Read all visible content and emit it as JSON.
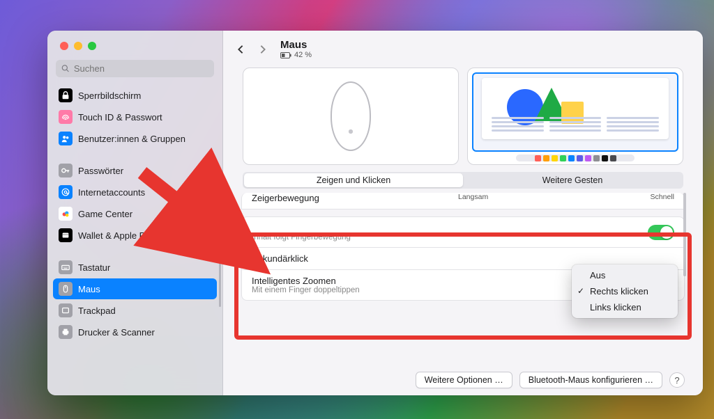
{
  "search": {
    "placeholder": "Suchen"
  },
  "sidebar": {
    "items": [
      {
        "label": "Sperrbildschirm",
        "icon": "lock-screen",
        "bg": "#000",
        "fg": "#fff"
      },
      {
        "label": "Touch ID & Passwort",
        "icon": "touchid",
        "bg": "#ff7aa8",
        "fg": "#fff"
      },
      {
        "label": "Benutzer:innen & Gruppen",
        "icon": "users",
        "bg": "#0a82ff",
        "fg": "#fff"
      },
      {
        "label": "Passwörter",
        "icon": "key",
        "bg": "#a1a1a8",
        "fg": "#fff"
      },
      {
        "label": "Internetaccounts",
        "icon": "at",
        "bg": "#0a82ff",
        "fg": "#fff"
      },
      {
        "label": "Game Center",
        "icon": "gamecenter",
        "bg": "#fff",
        "fg": "#ff4b4b"
      },
      {
        "label": "Wallet & Apple Pay",
        "icon": "wallet",
        "bg": "#000",
        "fg": "#fff"
      },
      {
        "label": "Tastatur",
        "icon": "keyboard",
        "bg": "#a1a1a8",
        "fg": "#fff"
      },
      {
        "label": "Maus",
        "icon": "mouse",
        "bg": "#a1a1a8",
        "fg": "#fff",
        "selected": true
      },
      {
        "label": "Trackpad",
        "icon": "trackpad",
        "bg": "#a1a1a8",
        "fg": "#fff"
      },
      {
        "label": "Drucker & Scanner",
        "icon": "printer",
        "bg": "#a1a1a8",
        "fg": "#fff"
      }
    ]
  },
  "header": {
    "title": "Maus",
    "battery": "42 %"
  },
  "tabs": {
    "a": "Zeigen und Klicken",
    "b": "Weitere Gesten"
  },
  "rows": {
    "tracking": {
      "label": "Zeigerbewegung",
      "slow": "Langsam",
      "fast": "Schnell"
    },
    "scroll": {
      "sub": "Inhalt folgt Fingerbewegung"
    },
    "secondary": {
      "label": "Sekundärklick"
    },
    "zoom": {
      "label": "Intelligentes Zoomen",
      "sub": "Mit einem Finger doppeltippen"
    }
  },
  "popup": {
    "off": "Aus",
    "right": "Rechts klicken",
    "left": "Links klicken"
  },
  "footer": {
    "more": "Weitere Optionen …",
    "bt": "Bluetooth-Maus konfigurieren …",
    "help": "?"
  },
  "dock_colors": [
    "#ff5f57",
    "#ff9f0a",
    "#ffd60a",
    "#30d158",
    "#0a84ff",
    "#5e5ce6",
    "#bf5af2",
    "#8e8e93",
    "#111",
    "#4a4a4f"
  ],
  "annot": {
    "redbox_label": "highlighted-settings-area"
  }
}
